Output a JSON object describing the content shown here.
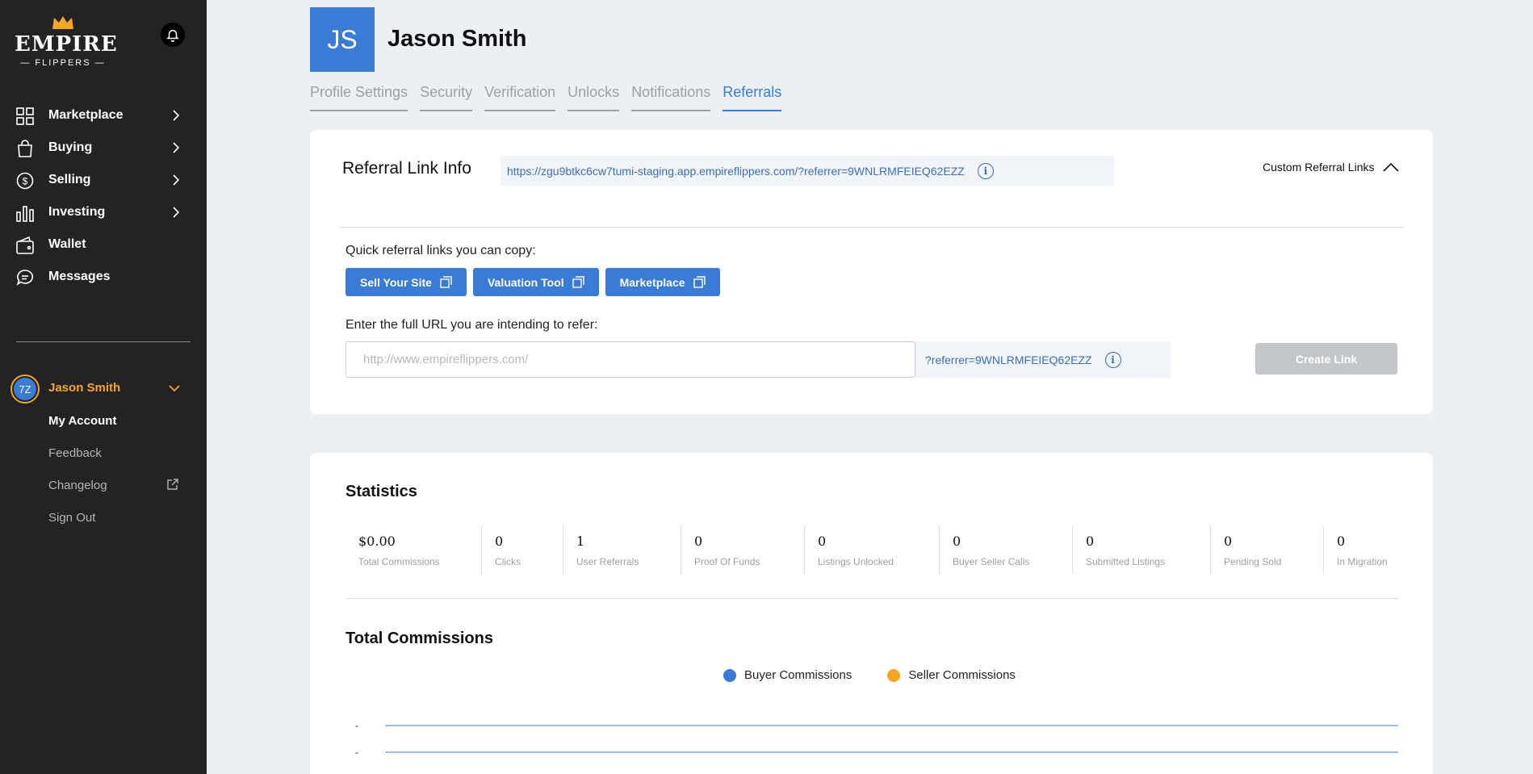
{
  "sidebar": {
    "logo_big": "EMPIRE",
    "logo_small": "— FLIPPERS —",
    "nav": [
      {
        "label": "Marketplace",
        "icon": "grid-icon"
      },
      {
        "label": "Buying",
        "icon": "bag-icon"
      },
      {
        "label": "Selling",
        "icon": "dollar-icon"
      },
      {
        "label": "Investing",
        "icon": "bar-chart-icon"
      },
      {
        "label": "Wallet",
        "icon": "wallet-icon"
      },
      {
        "label": "Messages",
        "icon": "chat-icon"
      }
    ],
    "user": {
      "initials": "7Z",
      "name": "Jason Smith",
      "menu": [
        "My Account",
        "Feedback",
        "Changelog",
        "Sign Out"
      ]
    }
  },
  "header": {
    "initials": "JS",
    "name": "Jason Smith",
    "tabs": [
      "Profile Settings",
      "Security",
      "Verification",
      "Unlocks",
      "Notifications",
      "Referrals"
    ],
    "active_tab": "Referrals"
  },
  "referral": {
    "title": "Referral Link Info",
    "url": "https://zgu9btkc6cw7tumi-staging.app.empireflippers.com/?referrer=9WNLRMFEIEQ62EZZ",
    "info_glyph": "i",
    "custom_links_label": "Custom Referral Links",
    "quick_label": "Quick referral links you can copy:",
    "quick_buttons": [
      "Sell Your Site",
      "Valuation Tool",
      "Marketplace"
    ],
    "url_label": "Enter the full URL you are intending to refer:",
    "url_placeholder": "http://www.empireflippers.com/",
    "url_value": "",
    "suffix": "?referrer=9WNLRMFEIEQ62EZZ",
    "create_button": "Create Link"
  },
  "statistics": {
    "title": "Statistics",
    "items": [
      {
        "value": "$0.00",
        "label": "Total Commissions"
      },
      {
        "value": "0",
        "label": "Clicks"
      },
      {
        "value": "1",
        "label": "User Referrals"
      },
      {
        "value": "0",
        "label": "Proof Of Funds"
      },
      {
        "value": "0",
        "label": "Listings Unlocked"
      },
      {
        "value": "0",
        "label": "Buyer Seller Calls"
      },
      {
        "value": "0",
        "label": "Submitted Listings"
      },
      {
        "value": "0",
        "label": "Pending Sold"
      },
      {
        "value": "0",
        "label": "In Migration"
      }
    ]
  },
  "chart_data": {
    "type": "line",
    "title": "Total Commissions",
    "series": [
      {
        "name": "Buyer Commissions",
        "color": "#3a7bd5",
        "values": []
      },
      {
        "name": "Seller Commissions",
        "color": "#f5a623",
        "values": []
      }
    ],
    "y_tick_labels": [
      "-",
      "-"
    ],
    "legend": "top-center"
  },
  "colors": {
    "accent": "#3a7bd5",
    "user_highlight": "#f5a623",
    "sidebar_bg": "#232323"
  }
}
